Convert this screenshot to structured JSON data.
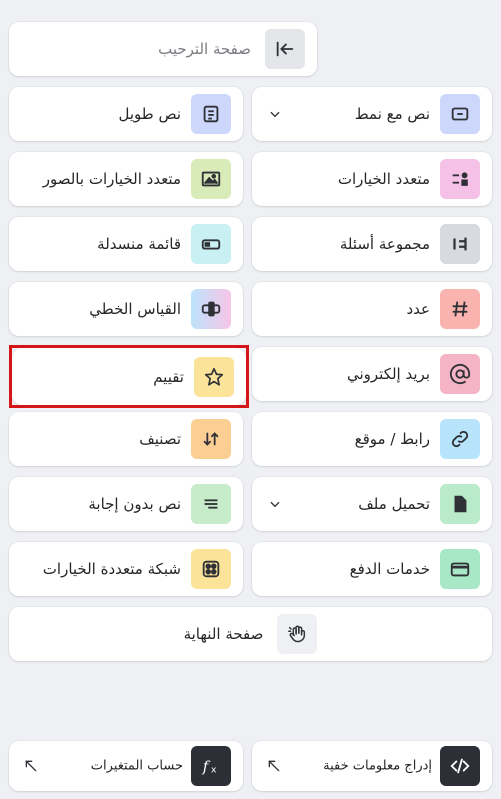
{
  "welcome": {
    "label": "صفحة الترحيب",
    "icon": "arrow-left-to-bar-icon"
  },
  "items": {
    "text_style": {
      "label": "نص مع نمط",
      "icon": "text-box-icon",
      "color": "#cdd7fb"
    },
    "long_text": {
      "label": "نص طويل",
      "icon": "document-lines-icon",
      "color": "#cdd7fb"
    },
    "multiple_choice": {
      "label": "متعدد الخيارات",
      "icon": "choice-list-icon",
      "color": "#f5c1e6"
    },
    "picture_choice": {
      "label": "متعدد الخيارات بالصور",
      "icon": "image-icon",
      "color": "#d9ebb8"
    },
    "question_group": {
      "label": "مجموعة أسئلة",
      "icon": "group-icon",
      "color": "#d8dae0"
    },
    "dropdown": {
      "label": "قائمة منسدلة",
      "icon": "dropdown-toggle-icon",
      "color": "#c9f0f2"
    },
    "number": {
      "label": "عدد",
      "icon": "hash-icon",
      "color": "#f9b4b0"
    },
    "opinion_scale": {
      "label": "القياس الخطي",
      "icon": "scale-icon",
      "color": "#f9c4e6"
    },
    "email": {
      "label": "بريد إلكتروني",
      "icon": "at-icon",
      "color": "#f5b3c6"
    },
    "rating": {
      "label": "تقييم",
      "icon": "star-icon",
      "color": "#fbe39a"
    },
    "website": {
      "label": "رابط / موقع",
      "icon": "link-icon",
      "color": "#b8e4fb"
    },
    "ranking": {
      "label": "تصنيف",
      "icon": "sort-arrows-icon",
      "color": "#fbcf93"
    },
    "file_upload": {
      "label": "تحميل ملف",
      "icon": "file-icon",
      "color": "#b9eac9"
    },
    "statement": {
      "label": "نص بدون إجابة",
      "icon": "lines-icon",
      "color": "#c7ecc9"
    },
    "payment": {
      "label": "خدمات الدفع",
      "icon": "credit-card-icon",
      "color": "#a8e8c6"
    },
    "matrix": {
      "label": "شبكة متعددة الخيارات",
      "icon": "grid-icon",
      "color": "#fbe39a"
    }
  },
  "ending": {
    "label": "صفحة النهاية",
    "icon": "waving-hand-icon"
  },
  "footer": {
    "hidden_fields": {
      "label": "إدراج معلومات خفية",
      "icon": "code-icon"
    },
    "calculator": {
      "label": "حساب المتغيرات",
      "icon": "function-icon"
    }
  }
}
